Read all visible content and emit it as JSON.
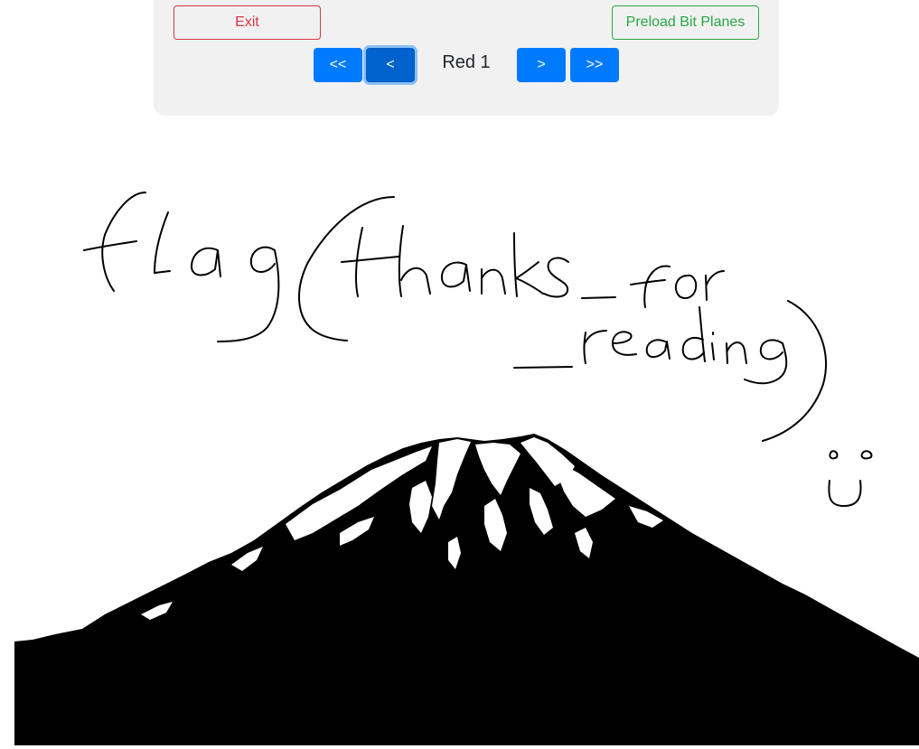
{
  "controls": {
    "exit_label": "Exit",
    "preload_label": "Preload Bit Planes",
    "first_label": "<<",
    "prev_label": "<",
    "next_label": ">",
    "last_label": ">>",
    "plane_label": "Red 1"
  },
  "colors": {
    "exit": "#dc3545",
    "preload": "#28a745",
    "nav": "#007bff",
    "nav_active": "#0062cc",
    "panel": "#f1f1f1"
  }
}
